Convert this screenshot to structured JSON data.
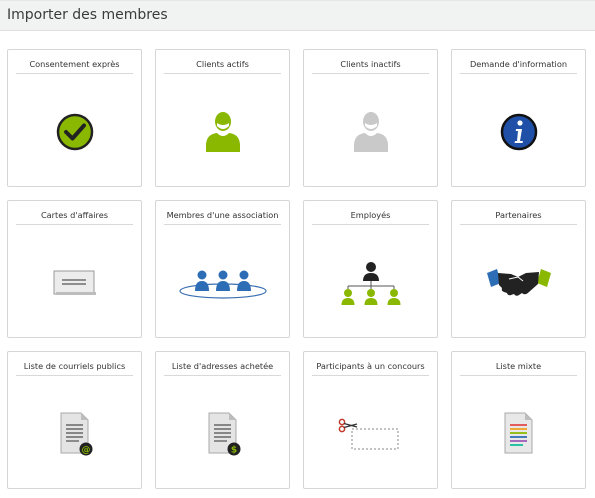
{
  "page": {
    "title": "Importer des membres"
  },
  "cards": [
    {
      "label": "Consentement exprès",
      "icon": "checkmark-icon"
    },
    {
      "label": "Clients actifs",
      "icon": "active-client-icon"
    },
    {
      "label": "Clients inactifs",
      "icon": "inactive-client-icon"
    },
    {
      "label": "Demande d'information",
      "icon": "info-icon"
    },
    {
      "label": "Cartes d'affaires",
      "icon": "business-card-icon"
    },
    {
      "label": "Membres d'une association",
      "icon": "association-members-icon"
    },
    {
      "label": "Employés",
      "icon": "employees-org-icon"
    },
    {
      "label": "Partenaires",
      "icon": "handshake-icon"
    },
    {
      "label": "Liste de courriels publics",
      "icon": "document-email-icon"
    },
    {
      "label": "Liste d'adresses achetée",
      "icon": "document-dollar-icon"
    },
    {
      "label": "Participants à un concours",
      "icon": "scissors-coupon-icon"
    },
    {
      "label": "Liste mixte",
      "icon": "colored-document-icon"
    }
  ],
  "colors": {
    "green": "#8ab800",
    "gray": "#c9c9c9",
    "blue": "#1f4fa6",
    "dark": "#222222",
    "header_bg": "#f1f2f2"
  }
}
